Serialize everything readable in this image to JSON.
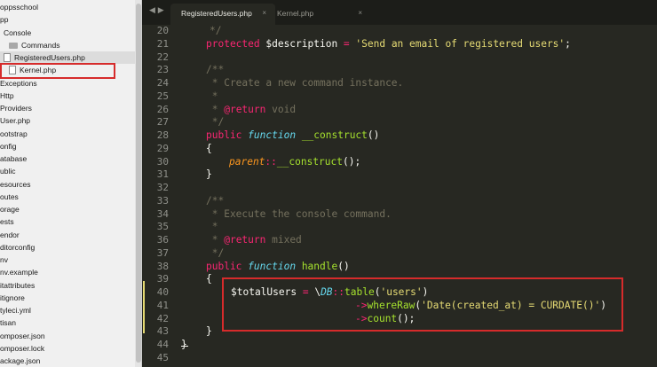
{
  "sidebar": {
    "items": [
      {
        "label": "oppsschool",
        "kind": "text"
      },
      {
        "label": "pp",
        "kind": "text"
      },
      {
        "label": "Console",
        "kind": "text"
      },
      {
        "label": "Commands",
        "kind": "folder"
      },
      {
        "label": "RegisteredUsers.php",
        "kind": "file"
      },
      {
        "label": "Kernel.php",
        "kind": "file"
      },
      {
        "label": "Exceptions",
        "kind": "text"
      },
      {
        "label": "Http",
        "kind": "text"
      },
      {
        "label": "Providers",
        "kind": "text"
      },
      {
        "label": "User.php",
        "kind": "text"
      },
      {
        "label": "ootstrap",
        "kind": "text"
      },
      {
        "label": "onfig",
        "kind": "text"
      },
      {
        "label": "atabase",
        "kind": "text"
      },
      {
        "label": "ublic",
        "kind": "text"
      },
      {
        "label": "esources",
        "kind": "text"
      },
      {
        "label": "outes",
        "kind": "text"
      },
      {
        "label": "orage",
        "kind": "text"
      },
      {
        "label": "ests",
        "kind": "text"
      },
      {
        "label": "endor",
        "kind": "text"
      },
      {
        "label": "ditorconfig",
        "kind": "text"
      },
      {
        "label": "nv",
        "kind": "text"
      },
      {
        "label": "nv.example",
        "kind": "text"
      },
      {
        "label": "itattributes",
        "kind": "text"
      },
      {
        "label": "itignore",
        "kind": "text"
      },
      {
        "label": "tyleci.yml",
        "kind": "text"
      },
      {
        "label": "tisan",
        "kind": "text"
      },
      {
        "label": "omposer.json",
        "kind": "text"
      },
      {
        "label": "omposer.lock",
        "kind": "text"
      },
      {
        "label": "ackage.json",
        "kind": "text"
      }
    ]
  },
  "tabs": [
    {
      "label": "RegisteredUsers.php",
      "close": "×",
      "active": true
    },
    {
      "label": "Kernel.php",
      "close": "×",
      "active": false
    }
  ],
  "nav": {
    "back": "◀",
    "forward": "▶"
  },
  "gutter": [
    "20",
    "21",
    "22",
    "23",
    "24",
    "25",
    "26",
    "27",
    "28",
    "29",
    "30",
    "31",
    "32",
    "33",
    "34",
    "35",
    "36",
    "37",
    "38",
    "39",
    "40",
    "41",
    "42",
    "43",
    "44",
    "45"
  ],
  "code": {
    "l20": "*/",
    "l21a": "protected",
    "l21b": " $description ",
    "l21c": "=",
    "l21d": " 'Send an email of registered users'",
    "l21e": ";",
    "l23": "/**",
    "l24": " * Create a new command instance.",
    "l25": " *",
    "l26a": " * ",
    "l26b": "@return",
    "l26c": " void",
    "l27": " */",
    "l28a": "public",
    "l28b": "function",
    "l28c": "__construct",
    "l28d": "()",
    "l29": "{",
    "l30a": "parent",
    "l30b": "::",
    "l30c": "__construct",
    "l30d": "();",
    "l31": "}",
    "l33": "/**",
    "l34": " * Execute the console command.",
    "l35": " *",
    "l36a": " * ",
    "l36b": "@return",
    "l36c": " mixed",
    "l37": " */",
    "l38a": "public",
    "l38b": "function",
    "l38c": "handle",
    "l38d": "()",
    "l39": "{",
    "l40a": "$totalUsers ",
    "l40b": "=",
    "l40c": " \\",
    "l40d": "DB",
    "l40e": "::",
    "l40f": "table",
    "l40g": "(",
    "l40h": "'users'",
    "l40i": ")",
    "l41a": "->",
    "l41b": "whereRaw",
    "l41c": "(",
    "l41d": "'Date(created_at) = CURDATE()'",
    "l41e": ")",
    "l42a": "->",
    "l42b": "count",
    "l42c": "();",
    "l43": "}",
    "l44": "}"
  }
}
